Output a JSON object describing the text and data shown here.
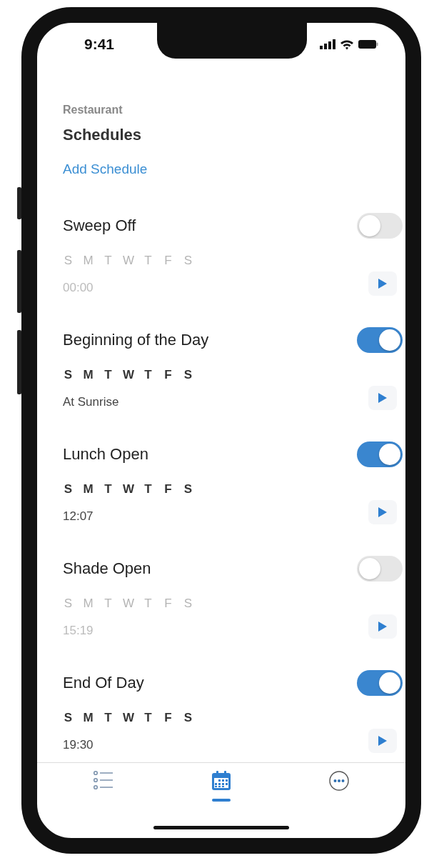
{
  "status_bar": {
    "time": "9:41"
  },
  "header": {
    "subtitle": "Restaurant",
    "title": "Schedules",
    "add_link": "Add Schedule"
  },
  "schedules": [
    {
      "name": "Sweep Off",
      "enabled": false,
      "days": [
        "S",
        "M",
        "T",
        "W",
        "T",
        "F",
        "S"
      ],
      "time": "00:00"
    },
    {
      "name": "Beginning of the Day",
      "enabled": true,
      "days": [
        "S",
        "M",
        "T",
        "W",
        "T",
        "F",
        "S"
      ],
      "time": "At Sunrise"
    },
    {
      "name": "Lunch Open",
      "enabled": true,
      "days": [
        "S",
        "M",
        "T",
        "W",
        "T",
        "F",
        "S"
      ],
      "time": "12:07"
    },
    {
      "name": "Shade Open",
      "enabled": false,
      "days": [
        "S",
        "M",
        "T",
        "W",
        "T",
        "F",
        "S"
      ],
      "time": "15:19"
    },
    {
      "name": "End Of Day",
      "enabled": true,
      "days": [
        "S",
        "M",
        "T",
        "W",
        "T",
        "F",
        "S"
      ],
      "time": "19:30"
    }
  ],
  "tab_bar": [
    {
      "kind": "list",
      "selected": false
    },
    {
      "kind": "calendar",
      "selected": true
    },
    {
      "kind": "more",
      "selected": false
    }
  ]
}
